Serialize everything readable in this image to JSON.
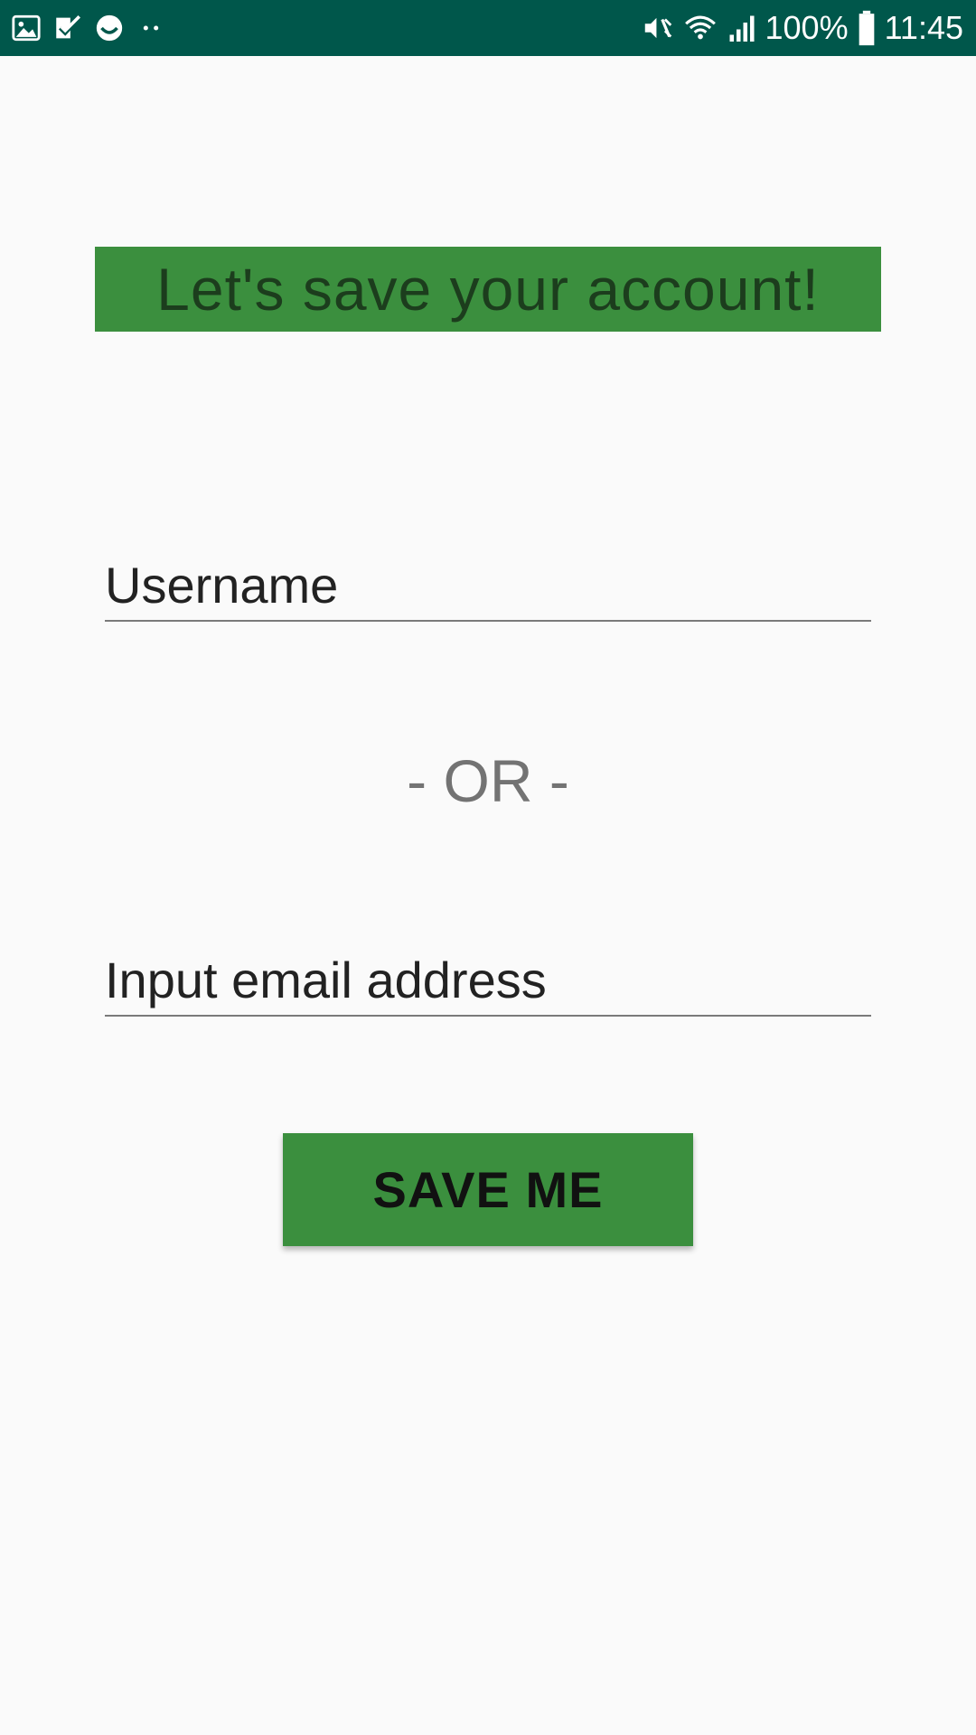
{
  "status_bar": {
    "left_icons": [
      "gallery-icon",
      "task-check-icon",
      "smiley-icon",
      "more-dots-icon"
    ],
    "right_icons": [
      "mute-vibrate-icon",
      "wifi-icon",
      "signal-icon",
      "battery-icon"
    ],
    "battery_percent": "100%",
    "time": "11:45",
    "background_color": "#00574b"
  },
  "header": {
    "title": "Let's save your account!",
    "banner_color": "#3b8f3e",
    "text_color": "#1c3d1d"
  },
  "form": {
    "username_placeholder": "Username",
    "username_value": "",
    "or_text": "- OR -",
    "email_placeholder": "Input email address",
    "email_value": "",
    "save_label": "SAVE ME",
    "button_color": "#3b8f3e"
  }
}
